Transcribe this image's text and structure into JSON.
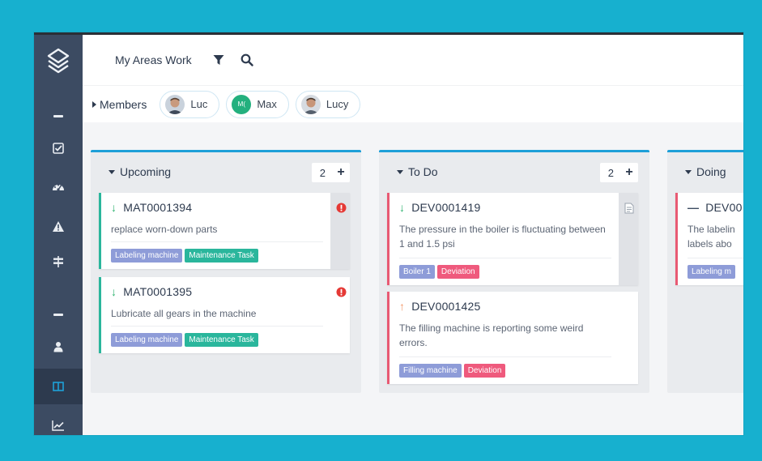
{
  "topbar": {
    "area_title": "My Areas Work"
  },
  "members": {
    "label": "Members",
    "chips": [
      {
        "name": "Luc",
        "avatar": "photo"
      },
      {
        "name": "Max",
        "initials": "M("
      },
      {
        "name": "Lucy",
        "avatar": "photo"
      }
    ]
  },
  "columns": [
    {
      "title": "Upcoming",
      "count": "2",
      "add": "+",
      "cards": [
        {
          "id": "MAT0001394",
          "priority": "low",
          "desc": "replace worn-down parts",
          "tags": [
            {
              "label": "Labeling machine",
              "kind": "machine"
            },
            {
              "label": "Maintenance Task",
              "kind": "task"
            }
          ],
          "indicator": "alert-icon"
        },
        {
          "id": "MAT0001395",
          "priority": "low",
          "desc": "Lubricate all gears in the machine",
          "tags": [
            {
              "label": "Labeling machine",
              "kind": "machine"
            },
            {
              "label": "Maintenance Task",
              "kind": "task"
            }
          ],
          "indicator": "alert-icon"
        }
      ]
    },
    {
      "title": "To Do",
      "count": "2",
      "add": "+",
      "cards": [
        {
          "id": "DEV0001419",
          "priority": "low",
          "desc": "The pressure in the boiler is fluctuating between 1 and 1.5 psi",
          "tags": [
            {
              "label": "Boiler 1",
              "kind": "machine"
            },
            {
              "label": "Deviation",
              "kind": "deviation"
            }
          ],
          "indicator": "document-icon"
        },
        {
          "id": "DEV0001425",
          "priority": "high",
          "desc": "The filling machine is reporting some weird errors.",
          "tags": [
            {
              "label": "Filling machine",
              "kind": "machine"
            },
            {
              "label": "Deviation",
              "kind": "deviation"
            }
          ],
          "indicator": ""
        }
      ]
    },
    {
      "title": "Doing",
      "count": "",
      "add": "",
      "cards": [
        {
          "id": "DEV00",
          "priority": "medium",
          "desc": "The labelin labels abo",
          "tags": [
            {
              "label": "Labeling m",
              "kind": "machine"
            }
          ],
          "indicator": ""
        }
      ]
    }
  ],
  "colors": {
    "background": "#17b0cf",
    "sidebar": "#3c4b62",
    "column_accent": "#1e9fd8",
    "task_border": "#2ab69c",
    "deviation_border": "#e85a73",
    "tag_machine": "#8e9cd8",
    "tag_task": "#2ab69c",
    "tag_deviation": "#ef5a7d",
    "priority_low": "#2fb36f",
    "priority_high": "#f39a6b",
    "alert": "#e53935"
  },
  "icons": {
    "sidebar": [
      "logo-layers-icon",
      "collapse-dash-icon",
      "checkbox-icon",
      "dashboard-gauge-icon",
      "warning-icon",
      "signpost-icon",
      "collapse-dash-icon",
      "user-icon",
      "board-columns-icon",
      "chart-line-icon"
    ],
    "topbar": [
      "filter-icon",
      "search-icon"
    ]
  }
}
